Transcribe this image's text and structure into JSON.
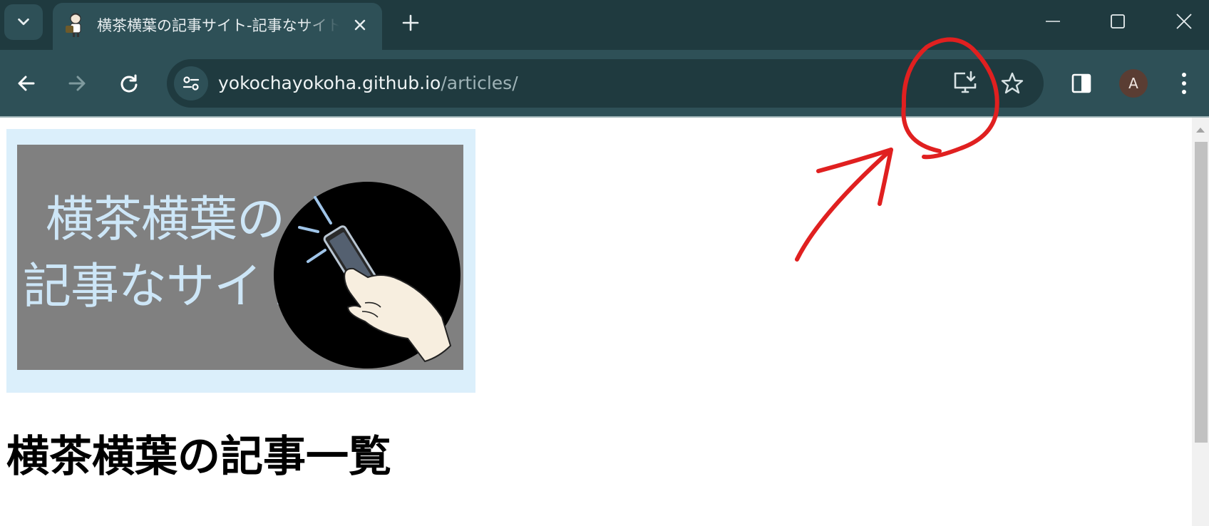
{
  "browser": {
    "tab": {
      "title": "横茶横葉の記事サイト-記事なサイト",
      "favicon": "site-favicon-character"
    },
    "address_bar": {
      "url_host": "yokochayokoha.github.io",
      "url_path": "/articles/"
    },
    "profile": {
      "initial": "A"
    },
    "icons": {
      "tab_search": "chevron-down-icon",
      "close_tab": "close-icon",
      "new_tab": "plus-icon",
      "minimize": "minimize-icon",
      "maximize": "maximize-icon",
      "close_window": "close-window-icon",
      "back": "back-arrow-icon",
      "forward": "forward-arrow-icon",
      "reload": "reload-icon",
      "site_info": "tune-icon",
      "install_app": "install-app-icon",
      "bookmark": "star-icon",
      "side_panel": "side-panel-icon",
      "menu": "more-vertical-icon"
    },
    "colors": {
      "tabstrip": "#1f3a3f",
      "toolbar": "#2e5057",
      "omnibox": "#1f3a3f"
    }
  },
  "page": {
    "banner": {
      "line1": "横茶横葉の",
      "line2": "記事なサイト",
      "background": "#808080",
      "frame": "#dbeffb",
      "text_color": "#cde6f7"
    },
    "heading": "横茶横葉の記事一覧"
  },
  "annotation": {
    "color": "#e02020",
    "target": "install-app-icon"
  }
}
